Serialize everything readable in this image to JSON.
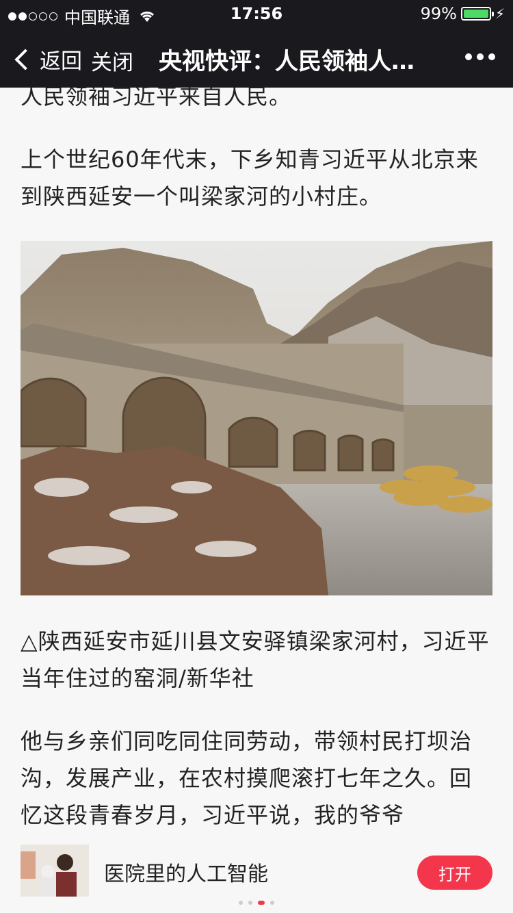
{
  "status_bar": {
    "carrier": "中国联通",
    "time": "17:56",
    "battery": "99%"
  },
  "nav": {
    "back_label": "返回",
    "close_label": "关闭",
    "title": "央视快评：人民领袖人…"
  },
  "article": {
    "paragraph_0": "人民领袖习近平来自人民。",
    "paragraph_1": "上个世纪60年代末，下乡知青习近平从北京来到陕西延安一个叫梁家河的小村庄。",
    "caption": "△陕西延安市延川县文安驿镇梁家河村，习近平当年住过的窑洞/新华社",
    "paragraph_2": "他与乡亲们同吃同住同劳动，带领村民打坝治沟，发展产业，在农村摸爬滚打七年之久。回忆这段青春岁月，习近平说，我的爷爷"
  },
  "promo": {
    "title": "医院里的人工智能",
    "open_label": "打开",
    "pager_count": 4,
    "pager_active": 3
  }
}
